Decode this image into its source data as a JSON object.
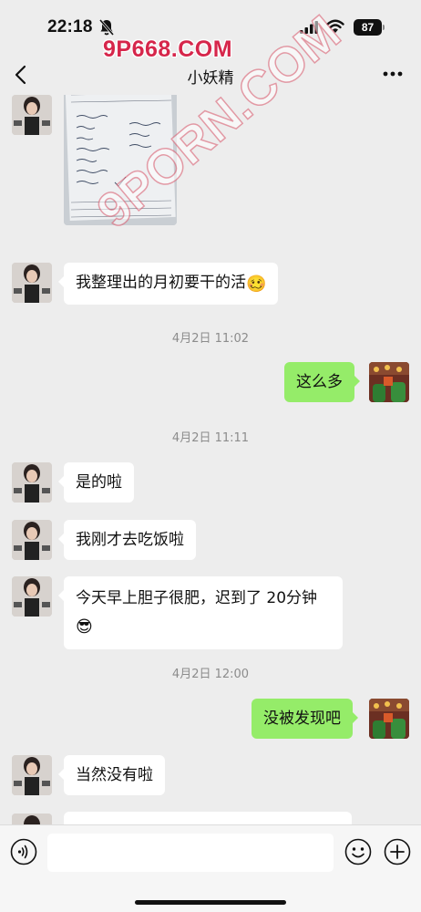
{
  "status_bar": {
    "time": "22:18",
    "battery": "87",
    "icons": [
      "bell-slash-icon",
      "signal-icon",
      "wifi-icon",
      "battery-icon"
    ]
  },
  "watermarks": {
    "top": "9P668.COM",
    "diagonal": "9PORN.COM"
  },
  "nav": {
    "title": "小妖精",
    "back_icon": "chevron-left-icon",
    "more_icon": "more-icon"
  },
  "messages": [
    {
      "side": "left",
      "type": "image",
      "description_icon": "photo-icon"
    },
    {
      "side": "left",
      "type": "text",
      "text": "我整理出的月初要干的活",
      "emoji": "🥴"
    },
    {
      "type": "timestamp",
      "text": "4月2日 11:02"
    },
    {
      "side": "right",
      "type": "text",
      "text": "这么多"
    },
    {
      "type": "timestamp",
      "text": "4月2日 11:11"
    },
    {
      "side": "left",
      "type": "text",
      "text": "是的啦"
    },
    {
      "side": "left",
      "type": "text",
      "text": "我刚才去吃饭啦"
    },
    {
      "side": "left",
      "type": "text",
      "text": "今天早上胆子很肥，迟到了 20分钟",
      "emoji": "😎"
    },
    {
      "type": "timestamp",
      "text": "4月2日 12:00"
    },
    {
      "side": "right",
      "type": "text",
      "text": "没被发现吧"
    },
    {
      "side": "left",
      "type": "text",
      "text": "当然没有啦"
    }
  ],
  "input_bar": {
    "placeholder": "",
    "icons": [
      "voice-icon",
      "emoji-icon",
      "plus-icon"
    ]
  },
  "colors": {
    "background": "#ededed",
    "bubble_left": "#ffffff",
    "bubble_right": "#95ec69",
    "watermark": "#d6264b"
  }
}
